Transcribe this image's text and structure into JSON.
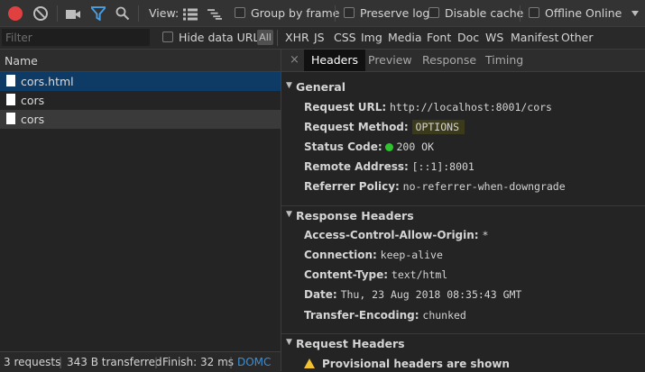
{
  "toolbar": {
    "record_icon": "record-icon",
    "clear_icon": "clear-icon",
    "view_label": "View:",
    "group_by_frame": "Group by frame",
    "preserve_log": "Preserve log",
    "disable_cache": "Disable cache",
    "offline": "Offline",
    "throttle": "Online"
  },
  "filterbar": {
    "placeholder": "Filter",
    "hide_data_urls": "Hide data URLs",
    "all": "All",
    "types": [
      "XHR",
      "JS",
      "CSS",
      "Img",
      "Media",
      "Font",
      "Doc",
      "WS",
      "Manifest",
      "Other"
    ]
  },
  "requests": {
    "header": "Name",
    "items": [
      "cors.html",
      "cors",
      "cors"
    ]
  },
  "statusbar": {
    "requests": "3 requests",
    "transferred": "343 B transferred",
    "finish": "Finish: 32 ms",
    "domc": "DOMC"
  },
  "tabs": {
    "close": "×",
    "items": [
      "Headers",
      "Preview",
      "Response",
      "Timing"
    ]
  },
  "general": {
    "title": "General",
    "request_url_k": "Request URL:",
    "request_url_v": "http://localhost:8001/cors",
    "request_method_k": "Request Method:",
    "request_method_v": "OPTIONS",
    "status_code_k": "Status Code:",
    "status_code_v": "200 OK",
    "remote_address_k": "Remote Address:",
    "remote_address_v": "[::1]:8001",
    "referrer_policy_k": "Referrer Policy:",
    "referrer_policy_v": "no-referrer-when-downgrade"
  },
  "response_headers": {
    "title": "Response Headers",
    "acao_k": "Access-Control-Allow-Origin:",
    "acao_v": "*",
    "connection_k": "Connection:",
    "connection_v": "keep-alive",
    "content_type_k": "Content-Type:",
    "content_type_v": "text/html",
    "date_k": "Date:",
    "date_v": "Thu, 23 Aug 2018 08:35:43 GMT",
    "transfer_encoding_k": "Transfer-Encoding:",
    "transfer_encoding_v": "chunked"
  },
  "request_headers": {
    "title": "Request Headers",
    "provisional": "Provisional headers are shown"
  },
  "colors": {
    "record": "#e04040",
    "filter_active": "#4a9de0",
    "selected_row": "#0e3a66",
    "status_ok": "#2ec42e",
    "method_highlight": "#e8d44d",
    "domc_link": "#3a8fd8"
  }
}
